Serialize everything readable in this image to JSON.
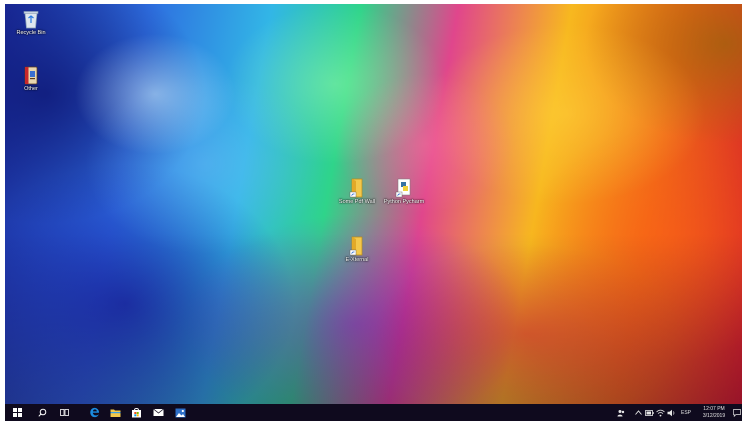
{
  "desktop": {
    "icons": [
      {
        "label": "Recycle Bin",
        "icon": "recycle-bin-icon"
      },
      {
        "label": "Other",
        "icon": "book-icon"
      },
      {
        "label": "Some Pdf Wall",
        "icon": "folder-icon"
      },
      {
        "label": "Python Pycharm",
        "icon": "python-icon"
      },
      {
        "label": "E-Xternal",
        "icon": "folder-shortcut-icon"
      }
    ]
  },
  "taskbar": {
    "buttons": [
      {
        "icon": "windows-start-icon"
      },
      {
        "icon": "search-icon"
      },
      {
        "icon": "task-view-icon"
      },
      {
        "icon": "edge-icon"
      },
      {
        "icon": "file-explorer-icon"
      },
      {
        "icon": "store-icon"
      },
      {
        "icon": "mail-icon"
      },
      {
        "icon": "photos-icon"
      }
    ],
    "tray": {
      "language": "ESP",
      "time": "12:07 PM",
      "date": "3/12/2019"
    }
  },
  "colors": {
    "taskbar": "#0f0a1e",
    "edge_blue": "#1b8ce0",
    "folder_yellow": "#f3c84b"
  }
}
